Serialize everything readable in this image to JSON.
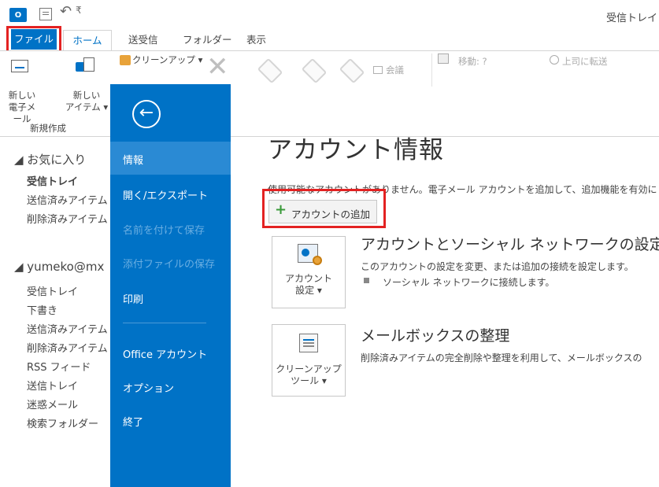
{
  "titlebar": {
    "app_icon": "O",
    "window_title": "受信トレイ"
  },
  "ribbon_tabs": [
    "ファイル",
    "ホーム",
    "送受信",
    "フォルダー",
    "表示"
  ],
  "ribbon": {
    "new_mail": "新しい\n電子メール",
    "new_item": "新しい\nアイテム ▾",
    "group_new": "新規作成",
    "cleanup": "クリーンアップ ▾",
    "meeting": "会議",
    "move": "移動: ?",
    "forward_to_manager": "上司に転送"
  },
  "nav": {
    "favorites_header": "◢ お気に入り",
    "favorites": [
      "受信トレイ",
      "送信済みアイテム",
      "削除済みアイテム"
    ],
    "account_header": "◢ yumeko@mx",
    "account_folders": [
      "受信トレイ",
      "下書き",
      "送信済みアイテム",
      "削除済みアイテム",
      "RSS フィード",
      "送信トレイ",
      "迷惑メール",
      "検索フォルダー"
    ]
  },
  "backstage": {
    "back_icon": "←",
    "items": [
      {
        "label": "情報",
        "state": "selected"
      },
      {
        "label": "開く/エクスポート",
        "state": "normal"
      },
      {
        "label": "名前を付けて保存",
        "state": "disabled"
      },
      {
        "label": "添付ファイルの保存",
        "state": "disabled"
      },
      {
        "label": "印刷",
        "state": "normal"
      },
      {
        "label": "Office アカウント",
        "state": "normal"
      },
      {
        "label": "オプション",
        "state": "normal"
      },
      {
        "label": "終了",
        "state": "normal"
      }
    ]
  },
  "content": {
    "title": "アカウント情報",
    "info": "使用可能なアカウントがありません。電子メール アカウントを追加して、追加機能を有効にして",
    "add_account": "アカウントの追加",
    "account_settings": {
      "tile_label": "アカウント\n設定 ▾",
      "title": "アカウントとソーシャル ネットワークの設定",
      "description": "このアカウントの設定を変更、または追加の接続を設定します。",
      "bullet": "ソーシャル ネットワークに接続します。"
    },
    "cleanup_tools": {
      "tile_label": "クリーンアップ\nツール ▾",
      "title": "メールボックスの整理",
      "description": "削除済みアイテムの完全削除や整理を利用して、メールボックスの"
    }
  },
  "colors": {
    "accent": "#0072C6",
    "highlight_box": "#e32222"
  }
}
